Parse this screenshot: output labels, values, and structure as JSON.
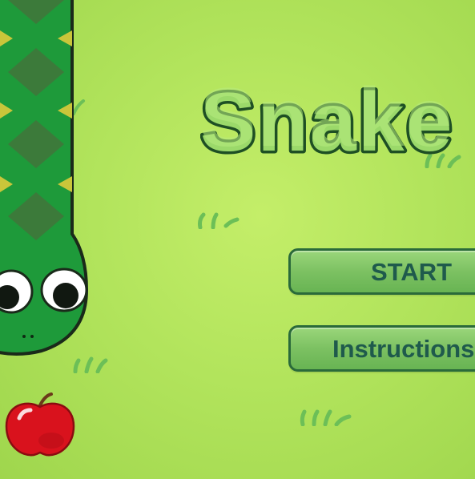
{
  "game": {
    "title": "Snake",
    "menu": {
      "start_label": "START",
      "instructions_label": "Instructions"
    }
  },
  "colors": {
    "background": "#b8e862",
    "snake_body": "#1e9a3a",
    "snake_pattern": "#3c7a3a",
    "snake_scale": "#c9c63a",
    "snake_outline": "#1a2a1a",
    "title_fill": "#9bd96a",
    "title_outline": "#1e4f24",
    "button_fill": "#7cc162",
    "button_border": "#2a6a3a",
    "button_text": "#1f5a4c",
    "apple": "#d9121d",
    "grass": "#6cbf57"
  },
  "icons": {
    "snake": "snake-icon",
    "apple": "apple-icon",
    "grass": "grass-tuft-icon"
  }
}
